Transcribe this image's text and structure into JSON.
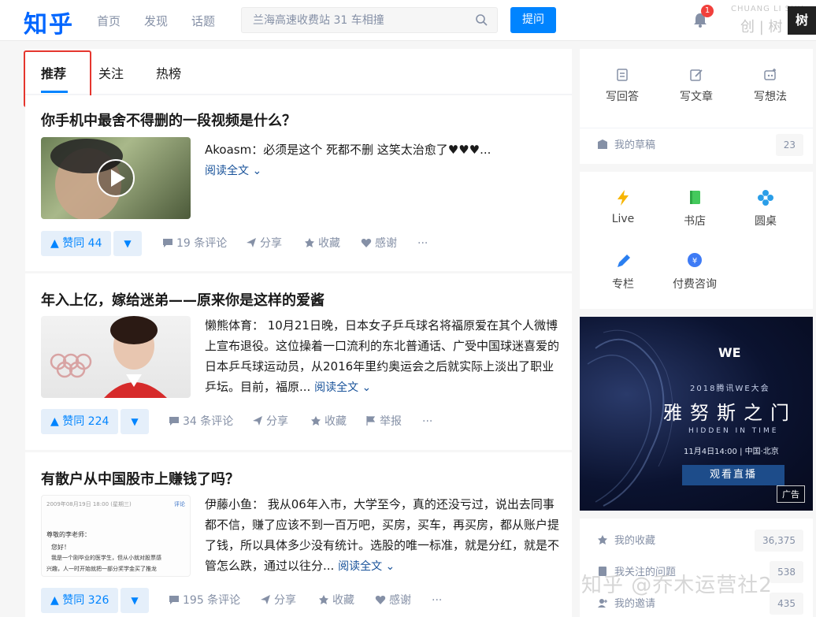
{
  "header": {
    "logo": "知乎",
    "nav": [
      "首页",
      "发现",
      "话题"
    ],
    "search_placeholder": "兰海高速收费站 31 车相撞",
    "ask_label": "提问",
    "notification_count": "1",
    "avatar_text": "树",
    "watermark_top": "CHUANG LI SHU",
    "watermark_main": "创 | 树"
  },
  "tabs": [
    "推荐",
    "关注",
    "热榜"
  ],
  "cards": [
    {
      "title": "你手机中最舍不得删的一段视频是什么？",
      "excerpt": "Akoasm：必须是这个 死都不删 这笑太治愈了♥♥♥...",
      "read_more": "阅读全文",
      "vote": "赞同 44",
      "actions": [
        "19 条评论",
        "分享",
        "收藏",
        "感谢",
        "···"
      ]
    },
    {
      "title": "年入上亿，嫁给迷弟——原来你是这样的爱酱",
      "excerpt": "懒熊体育： 10月21日晚，日本女子乒乓球名将福原爱在其个人微博上宣布退役。这位操着一口流利的东北普通话、广受中国球迷喜爱的日本乒乓球运动员，从2016年里约奥运会之后就实际上淡出了职业乒坛。目前，福原...",
      "read_more": "阅读全文",
      "vote": "赞同 224",
      "actions": [
        "34 条评论",
        "分享",
        "收藏",
        "举报",
        "···"
      ]
    },
    {
      "title": "有散户从中国股市上赚钱了吗？",
      "excerpt": "伊藤小鱼： 我从06年入市，大学至今，真的还没亏过，说出去同事都不信，赚了应该不到一百万吧，买房，买车，再买房，都从账户提了钱，所以具体多少没有统计。选股的唯一标准，就是分红，就是不管怎么跌，通过以往分...",
      "read_more": "阅读全文",
      "vote": "赞同 326",
      "actions": [
        "195 条评论",
        "分享",
        "收藏",
        "感谢",
        "···"
      ],
      "thumb_lines": [
        "2009年08月19日 18:00 (星期三)",
        "评论",
        "尊敬的李老师：",
        "您好！",
        "我是一个刚毕业的医学生，但从小就对股票感",
        "兴趣，人一时开始就把一部分奖学金买了推龙"
      ]
    }
  ],
  "sidebar": {
    "write": [
      {
        "label": "写回答",
        "icon": "answer-icon"
      },
      {
        "label": "写文章",
        "icon": "article-icon"
      },
      {
        "label": "写想法",
        "icon": "idea-icon"
      }
    ],
    "drafts_label": "我的草稿",
    "drafts_count": "23",
    "features": [
      {
        "label": "Live",
        "icon": "live-icon",
        "color": "#f7b500"
      },
      {
        "label": "书店",
        "icon": "bookstore-icon",
        "color": "#44c95c"
      },
      {
        "label": "圆桌",
        "icon": "roundtable-icon",
        "color": "#2a9ee8"
      },
      {
        "label": "专栏",
        "icon": "column-icon",
        "color": "#2a7ff0"
      },
      {
        "label": "付费咨询",
        "icon": "consult-icon",
        "color": "#3e7bf5"
      }
    ],
    "ad": {
      "logo": "WE",
      "subtitle": "2018腾讯WE大会",
      "title": "雅努斯之门",
      "tagline": "HIDDEN IN TIME",
      "time": "11月4日14:00 | 中国·北京",
      "button": "观看直播",
      "tag": "广告"
    },
    "links": [
      {
        "label": "我的收藏",
        "count": "36,375"
      },
      {
        "label": "我关注的问题",
        "count": "538"
      },
      {
        "label": "我的邀请",
        "count": "435"
      }
    ]
  },
  "footer_watermark": "知乎 @乔木运营社2"
}
